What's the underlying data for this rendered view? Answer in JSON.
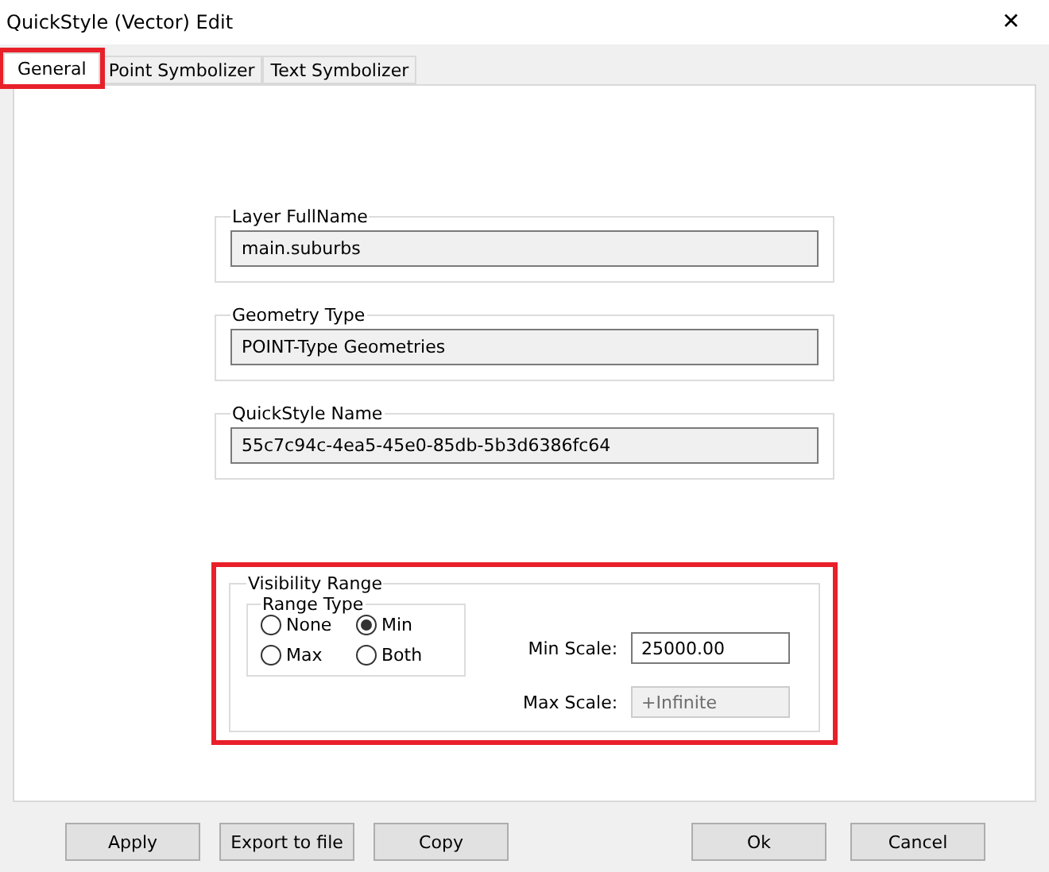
{
  "window": {
    "title": "QuickStyle (Vector) Edit",
    "close": "✕"
  },
  "tabs": [
    {
      "label": "General",
      "selected": true,
      "highlighted": true
    },
    {
      "label": "Point Symbolizer",
      "selected": false,
      "highlighted": false
    },
    {
      "label": "Text Symbolizer",
      "selected": false,
      "highlighted": false
    }
  ],
  "info_groups": [
    {
      "title": "Layer FullName",
      "value": "main.suburbs"
    },
    {
      "title": "Geometry Type",
      "value": "POINT-Type Geometries"
    },
    {
      "title": "QuickStyle Name",
      "value": "55c7c94c-4ea5-45e0-85db-5b3d6386fc64"
    }
  ],
  "visibility_range": {
    "title": "Visibility Range",
    "highlighted": true,
    "range_type": {
      "title": "Range Type",
      "options": [
        {
          "label": "None",
          "selected": false
        },
        {
          "label": "Min",
          "selected": true
        },
        {
          "label": "Max",
          "selected": false
        },
        {
          "label": "Both",
          "selected": false
        }
      ]
    },
    "scales": [
      {
        "label": "Min Scale:",
        "value": "25000.00",
        "disabled": false
      },
      {
        "label": "Max Scale:",
        "value": "+Infinite",
        "disabled": true
      }
    ]
  },
  "buttons_left": [
    "Apply",
    "Export to file",
    "Copy"
  ],
  "buttons_right": [
    "Ok",
    "Cancel"
  ]
}
